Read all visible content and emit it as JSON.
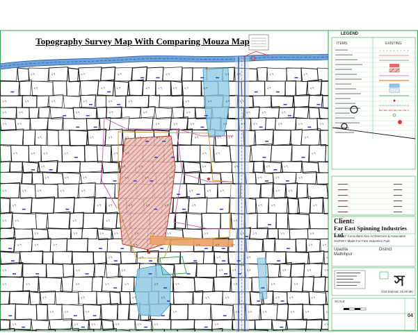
{
  "map": {
    "title": "Topography Survey Map With Comparing Mouza Map"
  },
  "legend": {
    "title": "LEGEND",
    "col_items": "ITEMS",
    "col_existing": "EXISTING"
  },
  "client": {
    "label": "Client:",
    "name": "Far East Spinning Industries Ltd.",
    "survey_line": "SURVEY Consultant:Alex Architecture & Associates",
    "project_line": "SURVEY Made For Fare Industries Park"
  },
  "location": {
    "upazila": "Upazila",
    "upazila_value": "Mathihpur",
    "district": "District"
  },
  "footer": {
    "scale_label": "SCALE",
    "sheet_no": "04",
    "contour_note": "Grid Interval: 25.00 Mtr."
  },
  "colors": {
    "mouza_line": "#1a1a1a",
    "river": "#4a7fc8",
    "pond": "#7ec3e0",
    "hatch": "#c0392b",
    "road_orange": "#e8a060",
    "border": "#2aa84a",
    "pink_line": "#c857b5",
    "tan_line": "#c89a3a"
  }
}
